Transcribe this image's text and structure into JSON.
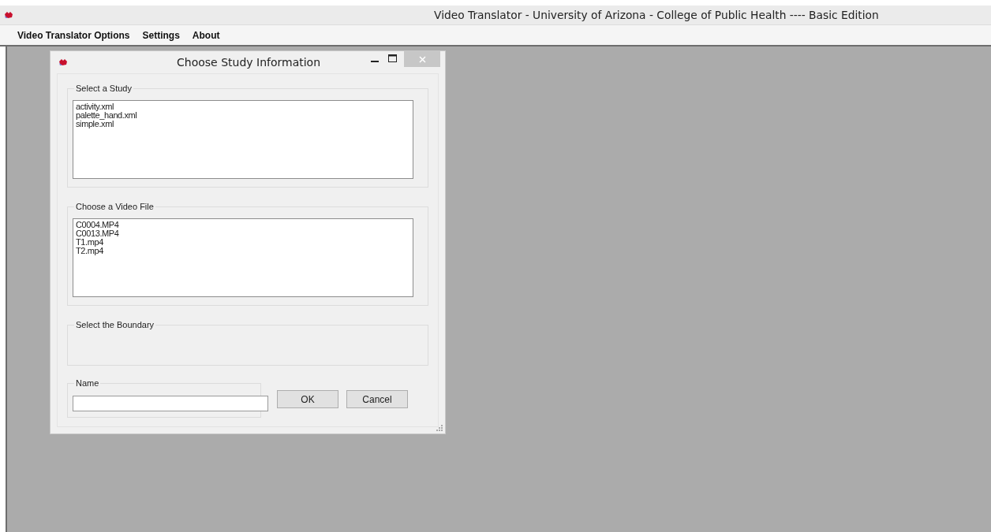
{
  "window": {
    "title": "Video Translator - University of Arizona - College of Public Health ---- Basic Edition"
  },
  "menu": [
    {
      "label": "Video Translator Options"
    },
    {
      "label": "Settings"
    },
    {
      "label": "About"
    }
  ],
  "dialog": {
    "title": "Choose Study Information",
    "study_group": {
      "label": "Select a Study",
      "items": [
        "activity.xml",
        "palette_hand.xml",
        "simple.xml"
      ]
    },
    "video_group": {
      "label": "Choose a Video File",
      "items": [
        "C0004.MP4",
        "C0013.MP4",
        "T1.mp4",
        "T2.mp4"
      ]
    },
    "boundary_group": {
      "label": "Select the Boundary"
    },
    "name_group": {
      "label": "Name"
    },
    "buttons": [
      "OK",
      "Cancel"
    ]
  }
}
